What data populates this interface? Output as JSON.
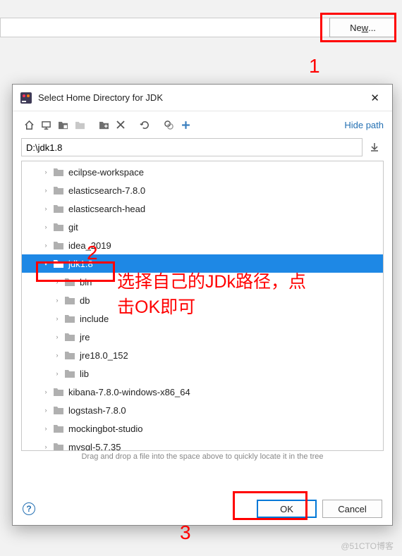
{
  "background": {
    "new_button_prefix": "Ne",
    "new_button_underlined": "w",
    "new_button_suffix": "..."
  },
  "dialog": {
    "title": "Select Home Directory for JDK",
    "hide_path": "Hide path",
    "path_value": "D:\\jdk1.8",
    "drag_hint": "Drag and drop a file into the space above to quickly locate it in the tree",
    "ok_label": "OK",
    "cancel_label": "Cancel"
  },
  "tree": [
    {
      "indent": 1,
      "expand": "right",
      "label": "ecilpse-workspace",
      "selected": false
    },
    {
      "indent": 1,
      "expand": "right",
      "label": "elasticsearch-7.8.0",
      "selected": false
    },
    {
      "indent": 1,
      "expand": "right",
      "label": "elasticsearch-head",
      "selected": false
    },
    {
      "indent": 1,
      "expand": "right",
      "label": "git",
      "selected": false
    },
    {
      "indent": 1,
      "expand": "right",
      "label": "idea_2019",
      "selected": false
    },
    {
      "indent": 1,
      "expand": "down",
      "label": "jdk1.8",
      "selected": true
    },
    {
      "indent": 2,
      "expand": "right",
      "label": "bin",
      "selected": false
    },
    {
      "indent": 2,
      "expand": "right",
      "label": "db",
      "selected": false
    },
    {
      "indent": 2,
      "expand": "right",
      "label": "include",
      "selected": false
    },
    {
      "indent": 2,
      "expand": "right",
      "label": "jre",
      "selected": false
    },
    {
      "indent": 2,
      "expand": "right",
      "label": "jre18.0_152",
      "selected": false
    },
    {
      "indent": 2,
      "expand": "right",
      "label": "lib",
      "selected": false
    },
    {
      "indent": 1,
      "expand": "right",
      "label": "kibana-7.8.0-windows-x86_64",
      "selected": false
    },
    {
      "indent": 1,
      "expand": "right",
      "label": "logstash-7.8.0",
      "selected": false
    },
    {
      "indent": 1,
      "expand": "right",
      "label": "mockingbot-studio",
      "selected": false
    },
    {
      "indent": 1,
      "expand": "right",
      "label": "mysql-5.7.35",
      "selected": false
    }
  ],
  "annotations": {
    "n1": "1",
    "n2": "2",
    "n3": "3",
    "instruction_line1": "选择自己的JDk路径，点",
    "instruction_line2": "击OK即可",
    "watermark": "@51CTO博客"
  }
}
